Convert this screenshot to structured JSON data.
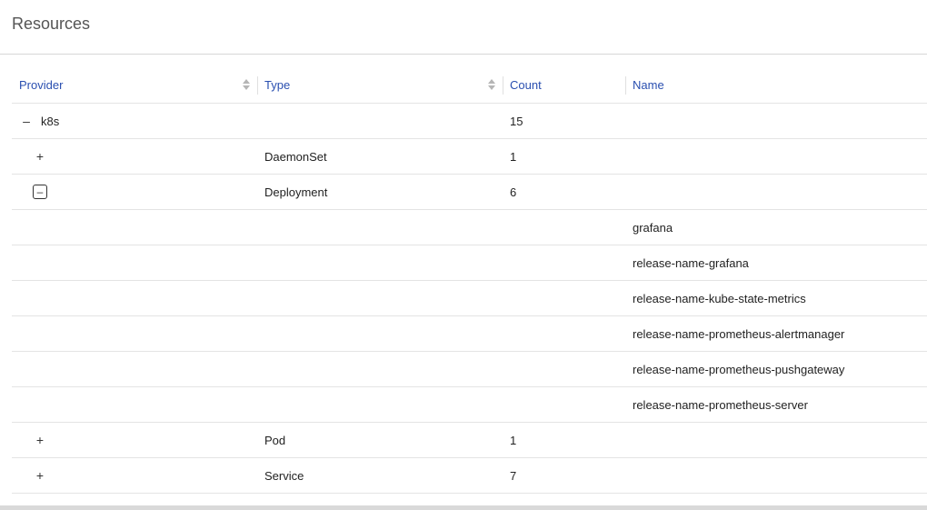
{
  "panel": {
    "title": "Resources"
  },
  "table": {
    "columns": [
      {
        "label": "Provider",
        "sortable": true
      },
      {
        "label": "Type",
        "sortable": true
      },
      {
        "label": "Count",
        "sortable": false
      },
      {
        "label": "Name",
        "sortable": false
      }
    ],
    "provider_row": {
      "toggle": "–",
      "provider": "k8s",
      "count": "15"
    },
    "type_rows": [
      {
        "toggle": "+",
        "type": "DaemonSet",
        "count": "1"
      },
      {
        "toggle": "–",
        "type": "Deployment",
        "count": "6"
      }
    ],
    "deployment_names": [
      "grafana",
      "release-name-grafana",
      "release-name-kube-state-metrics",
      "release-name-prometheus-alertmanager",
      "release-name-prometheus-pushgateway",
      "release-name-prometheus-server"
    ],
    "more_type_rows": [
      {
        "toggle": "+",
        "type": "Pod",
        "count": "1"
      },
      {
        "toggle": "+",
        "type": "Service",
        "count": "7"
      }
    ]
  },
  "colors": {
    "header_text": "#2a4fb0",
    "title_text": "#555555",
    "border": "#e4e4e4"
  }
}
